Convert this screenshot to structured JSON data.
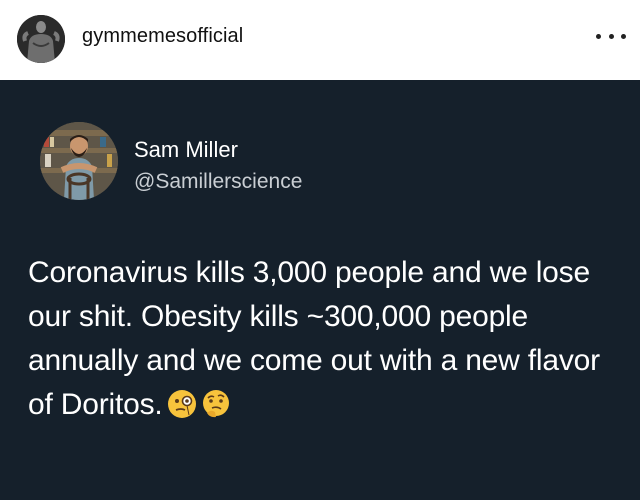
{
  "post": {
    "username": "gymmemesofficial",
    "avatar_icon": "bodybuilder-avatar",
    "more_icon": "more-options-icon"
  },
  "tweet": {
    "author_name": "Sam Miller",
    "author_handle": "@Samillerscience",
    "avatar_icon": "man-in-chair-avatar",
    "text": "Coronavirus kills 3,000 people and we lose our shit. Obesity kills ~300,000 people annually and we come out with a new flavor of Doritos.",
    "emojis": [
      "monocle-face-emoji",
      "thinking-face-emoji"
    ],
    "background_color": "#15202b"
  }
}
